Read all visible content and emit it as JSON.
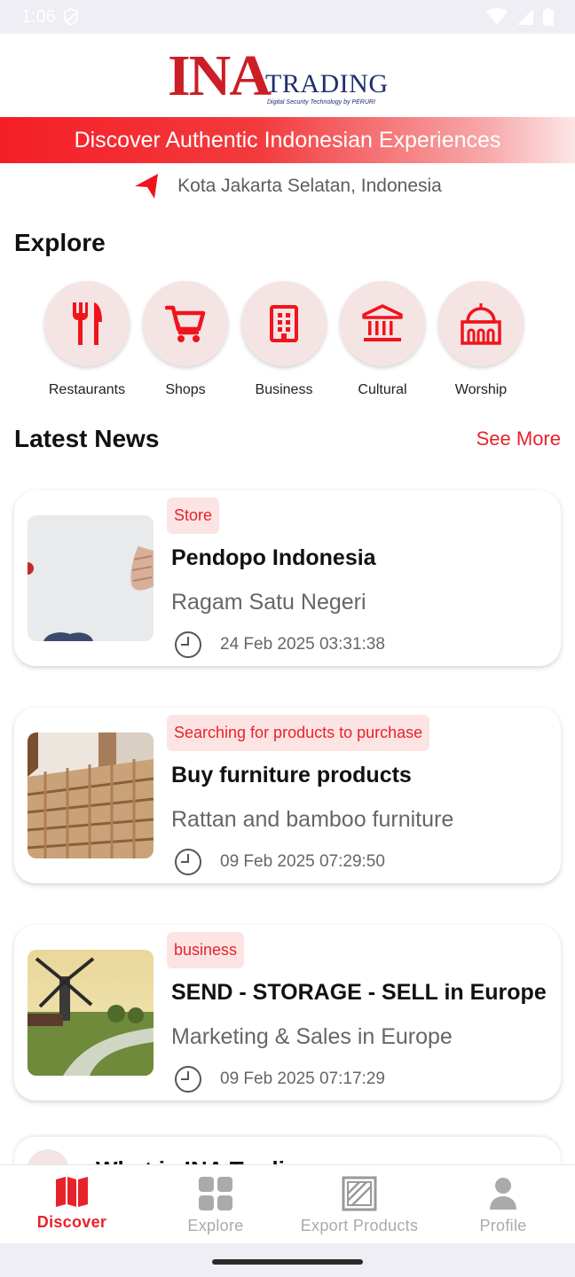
{
  "status_bar": {
    "time": "1:06"
  },
  "brand": {
    "logo_ina": "INA",
    "logo_trading": "TRADING",
    "logo_tagline": "Digital Security Technology by PERURI"
  },
  "banner": {
    "text": "Discover Authentic Indonesian Experiences"
  },
  "location": {
    "text": "Kota Jakarta Selatan, Indonesia"
  },
  "explore": {
    "title": "Explore",
    "items": [
      {
        "label": "Restaurants",
        "icon": "fork-knife-icon"
      },
      {
        "label": "Shops",
        "icon": "cart-icon"
      },
      {
        "label": "Business",
        "icon": "building-icon"
      },
      {
        "label": "Cultural",
        "icon": "museum-icon"
      },
      {
        "label": "Worship",
        "icon": "mosque-icon"
      }
    ]
  },
  "news": {
    "title": "Latest News",
    "see_more": "See More",
    "items": [
      {
        "tag": "Store",
        "title": "Pendopo Indonesia",
        "subtitle": "Ragam Satu Negeri",
        "time": "24 Feb 2025 03:31:38"
      },
      {
        "tag": "Searching for products to purchase",
        "title": "Buy furniture products",
        "subtitle": "Rattan and bamboo furniture",
        "time": "09 Feb 2025 07:29:50"
      },
      {
        "tag": "business",
        "title": "SEND - STORAGE - SELL in Europe",
        "subtitle": "Marketing & Sales in Europe",
        "time": "09 Feb 2025 07:17:29"
      }
    ],
    "partial_title": "What is INA Trading"
  },
  "bottom_nav": {
    "items": [
      {
        "label": "Discover",
        "active": true
      },
      {
        "label": "Explore",
        "active": false
      },
      {
        "label": "Export Products",
        "active": false
      },
      {
        "label": "Profile",
        "active": false
      }
    ]
  },
  "colors": {
    "accent": "#e8222a",
    "tag_bg": "#fde4e4",
    "icon_circle": "#f5e4e4",
    "muted": "#aaaaaa"
  }
}
